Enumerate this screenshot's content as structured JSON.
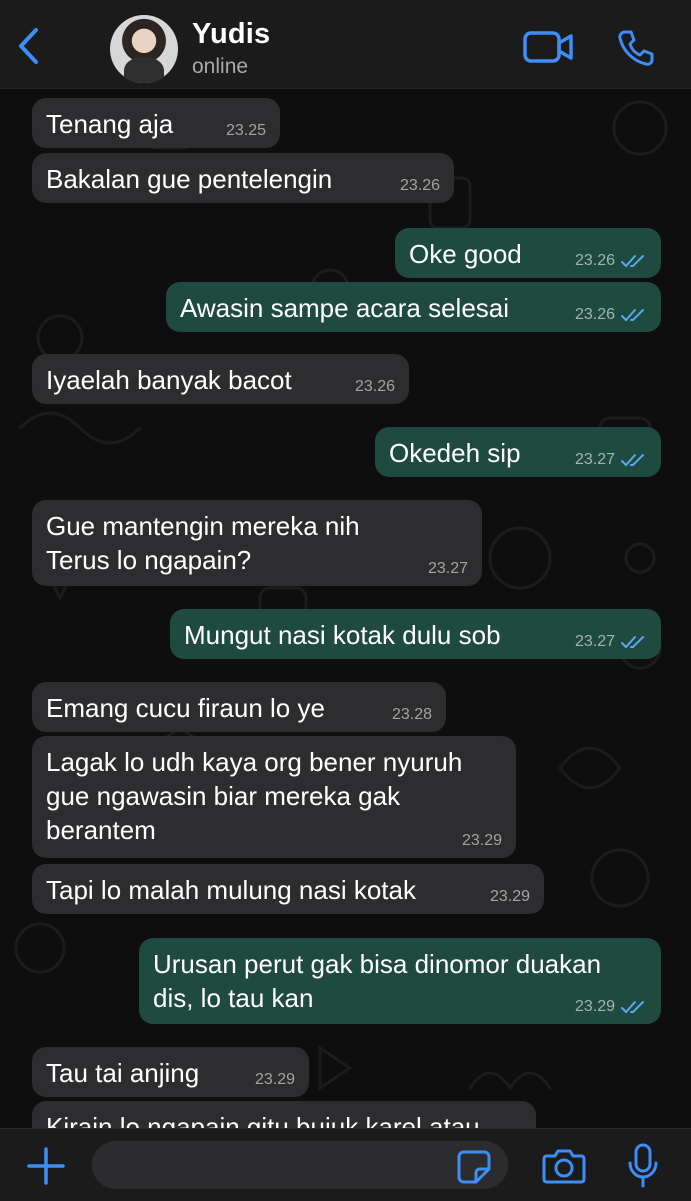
{
  "header": {
    "back_icon": "chevron-left-icon",
    "name": "Yudis",
    "status": "online",
    "video_icon": "video-camera-icon",
    "call_icon": "phone-icon",
    "accent_color": "#3e8ef7"
  },
  "messages": [
    {
      "dir": "in",
      "text": "Tenang aja",
      "time": "23.25"
    },
    {
      "dir": "in",
      "text": "Bakalan gue pentelengin",
      "time": "23.26"
    },
    {
      "dir": "out",
      "text": "Oke good",
      "time": "23.26",
      "read": true
    },
    {
      "dir": "out",
      "text": "Awasin sampe acara selesai",
      "time": "23.26",
      "read": true
    },
    {
      "dir": "in",
      "text": "Iyaelah banyak bacot",
      "time": "23.26"
    },
    {
      "dir": "out",
      "text": "Okedeh sip",
      "time": "23.27",
      "read": true
    },
    {
      "dir": "in",
      "text": "Gue mantengin mereka nih\nTerus lo ngapain?",
      "time": "23.27"
    },
    {
      "dir": "out",
      "text": "Mungut nasi kotak dulu sob",
      "time": "23.27",
      "read": true
    },
    {
      "dir": "in",
      "text": "Emang cucu firaun lo ye",
      "time": "23.28"
    },
    {
      "dir": "in",
      "text": "Lagak lo udh kaya org bener nyuruh\ngue ngawasin biar mereka gak\nberantem",
      "time": "23.29"
    },
    {
      "dir": "in",
      "text": "Tapi lo malah mulung nasi kotak",
      "time": "23.29"
    },
    {
      "dir": "out",
      "text": "Urusan perut gak bisa dinomor duakan\ndis, lo tau kan",
      "time": "23.29",
      "read": true
    },
    {
      "dir": "in",
      "text": "Tau tai anjing",
      "time": "23.29"
    },
    {
      "dir": "in",
      "text": "Kirain lo ngapain gitu bujuk karel atau",
      "time": ""
    }
  ],
  "composer": {
    "plus_icon": "plus-icon",
    "input_value": "",
    "sticker_icon": "sticker-icon",
    "camera_icon": "camera-icon",
    "mic_icon": "microphone-icon"
  }
}
